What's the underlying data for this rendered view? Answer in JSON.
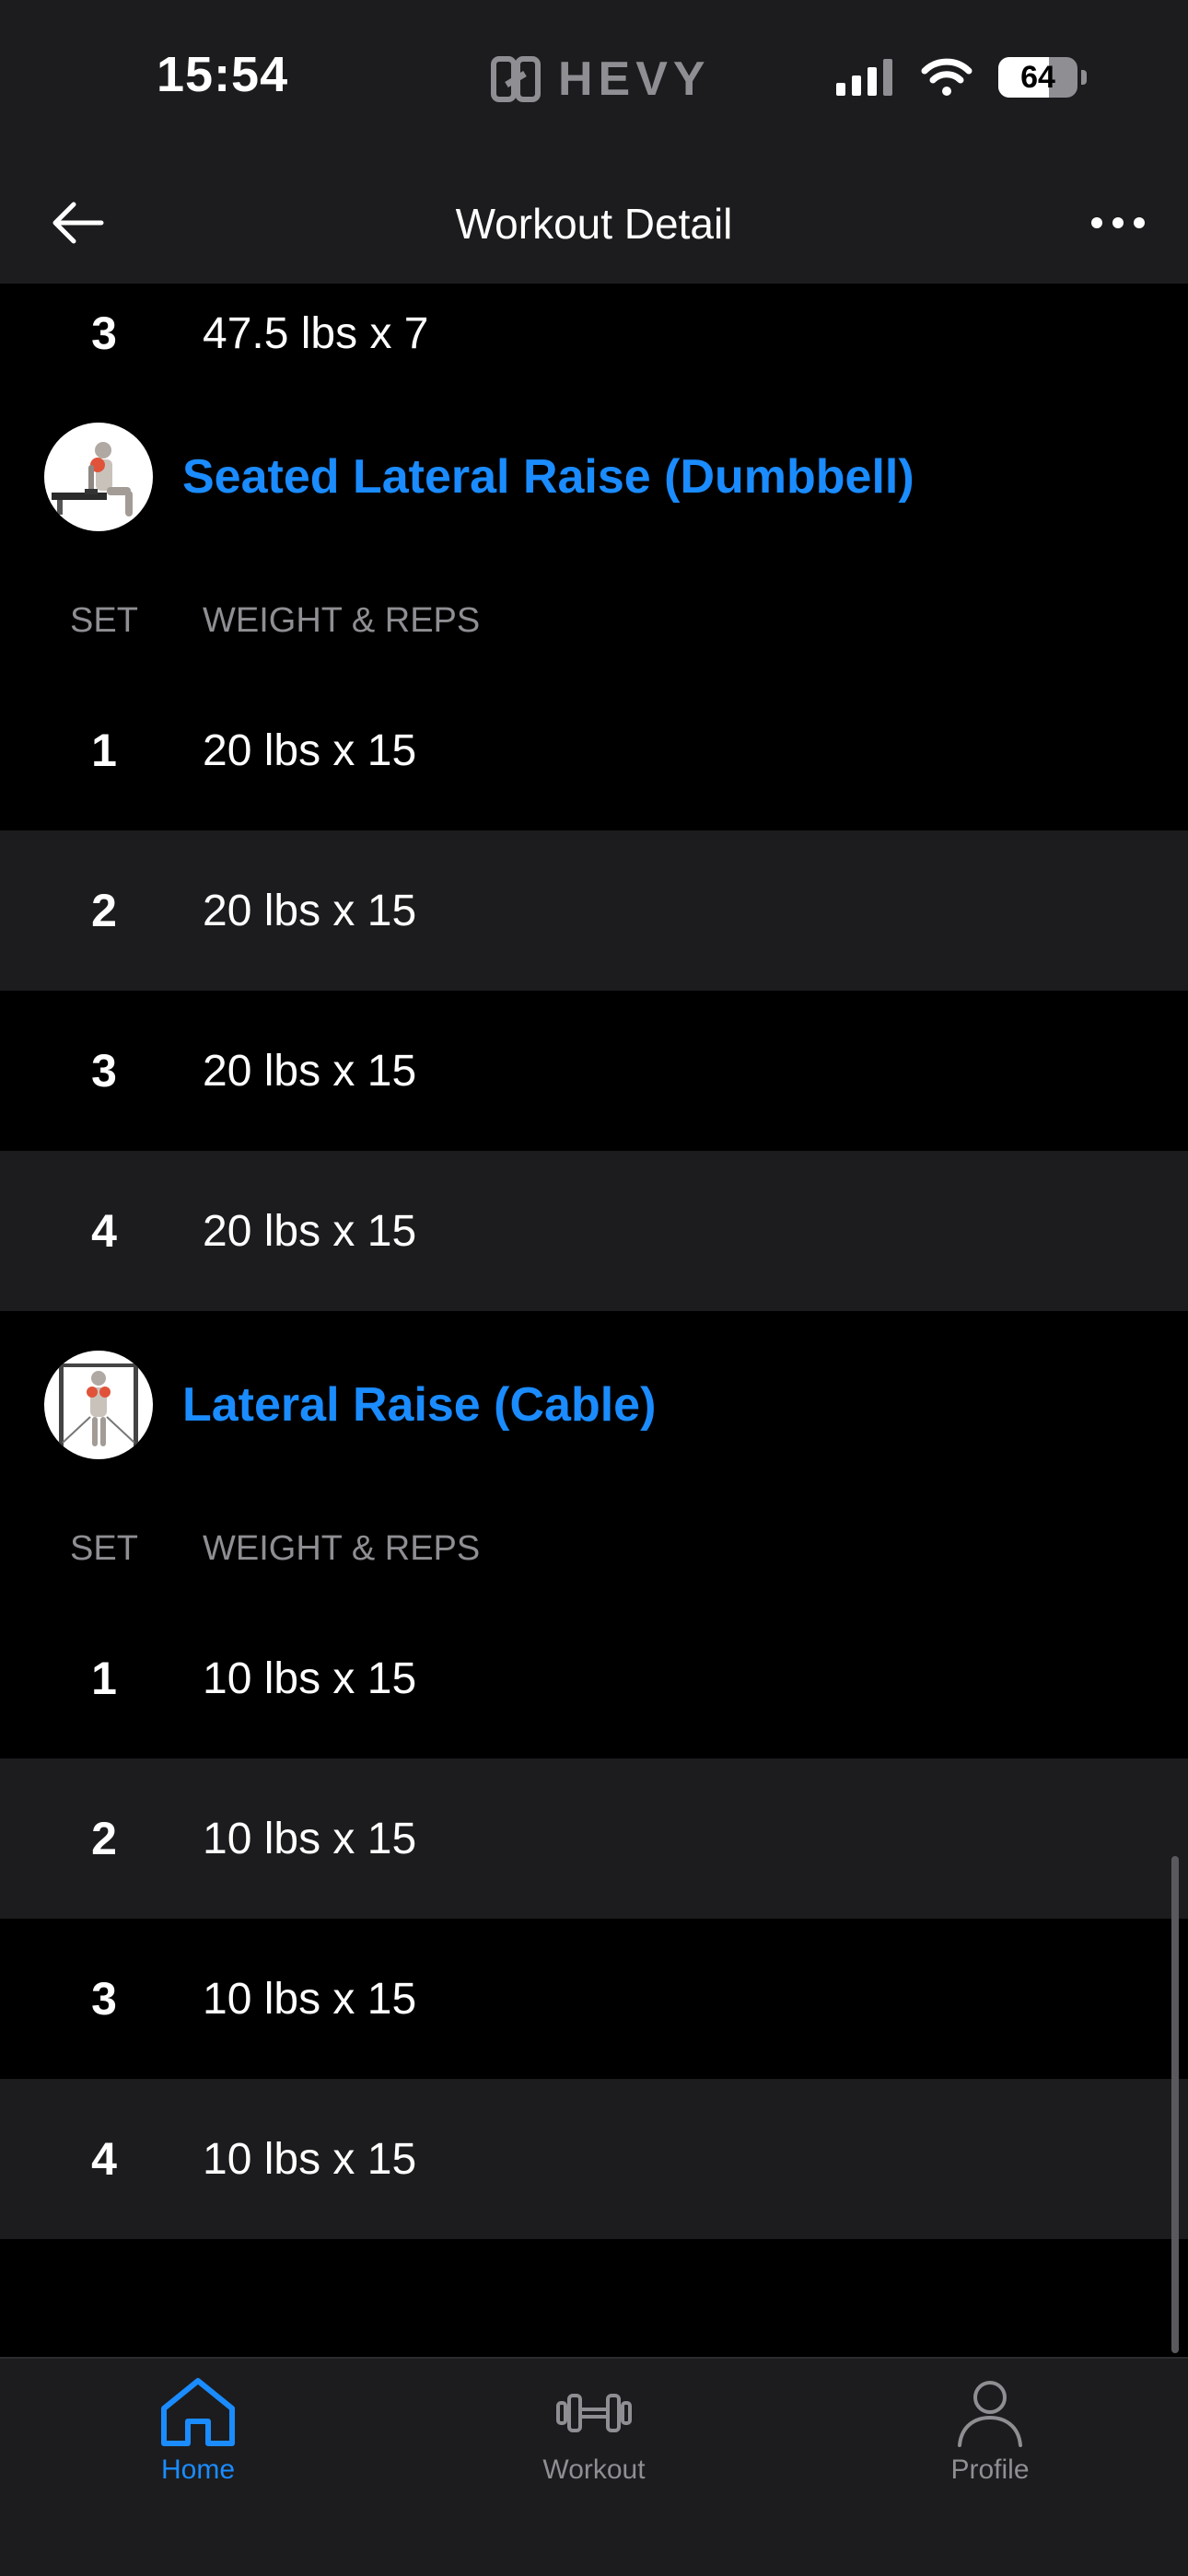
{
  "status_bar": {
    "time": "15:54",
    "logo_text": "HEVY",
    "battery_level": 64,
    "battery_text": "64",
    "signal_icon": "signal-bars-icon",
    "wifi_icon": "wifi-icon"
  },
  "header": {
    "title": "Workout Detail",
    "back_icon": "arrow-left-icon",
    "more_icon": "ellipsis-icon"
  },
  "previous_exercise_tail": {
    "set": "3",
    "value": "47.5 lbs x 7"
  },
  "exercises": [
    {
      "name": "Seated Lateral Raise (Dumbbell)",
      "column_set": "SET",
      "column_weight": "WEIGHT & REPS",
      "sets": [
        {
          "set": "1",
          "value": "20 lbs x 15"
        },
        {
          "set": "2",
          "value": "20 lbs x 15"
        },
        {
          "set": "3",
          "value": "20 lbs x 15"
        },
        {
          "set": "4",
          "value": "20 lbs x 15"
        }
      ]
    },
    {
      "name": "Lateral Raise (Cable)",
      "column_set": "SET",
      "column_weight": "WEIGHT & REPS",
      "sets": [
        {
          "set": "1",
          "value": "10 lbs x 15"
        },
        {
          "set": "2",
          "value": "10 lbs x 15"
        },
        {
          "set": "3",
          "value": "10 lbs x 15"
        },
        {
          "set": "4",
          "value": "10 lbs x 15"
        }
      ]
    }
  ],
  "tab_bar": {
    "tabs": [
      {
        "label": "Home",
        "icon": "home-icon",
        "active": true
      },
      {
        "label": "Workout",
        "icon": "dumbbell-icon",
        "active": false
      },
      {
        "label": "Profile",
        "icon": "person-icon",
        "active": false
      }
    ]
  },
  "colors": {
    "accent": "#1a8cff",
    "background": "#000000",
    "surface": "#1c1c1e",
    "muted_text": "#8e8e93"
  }
}
